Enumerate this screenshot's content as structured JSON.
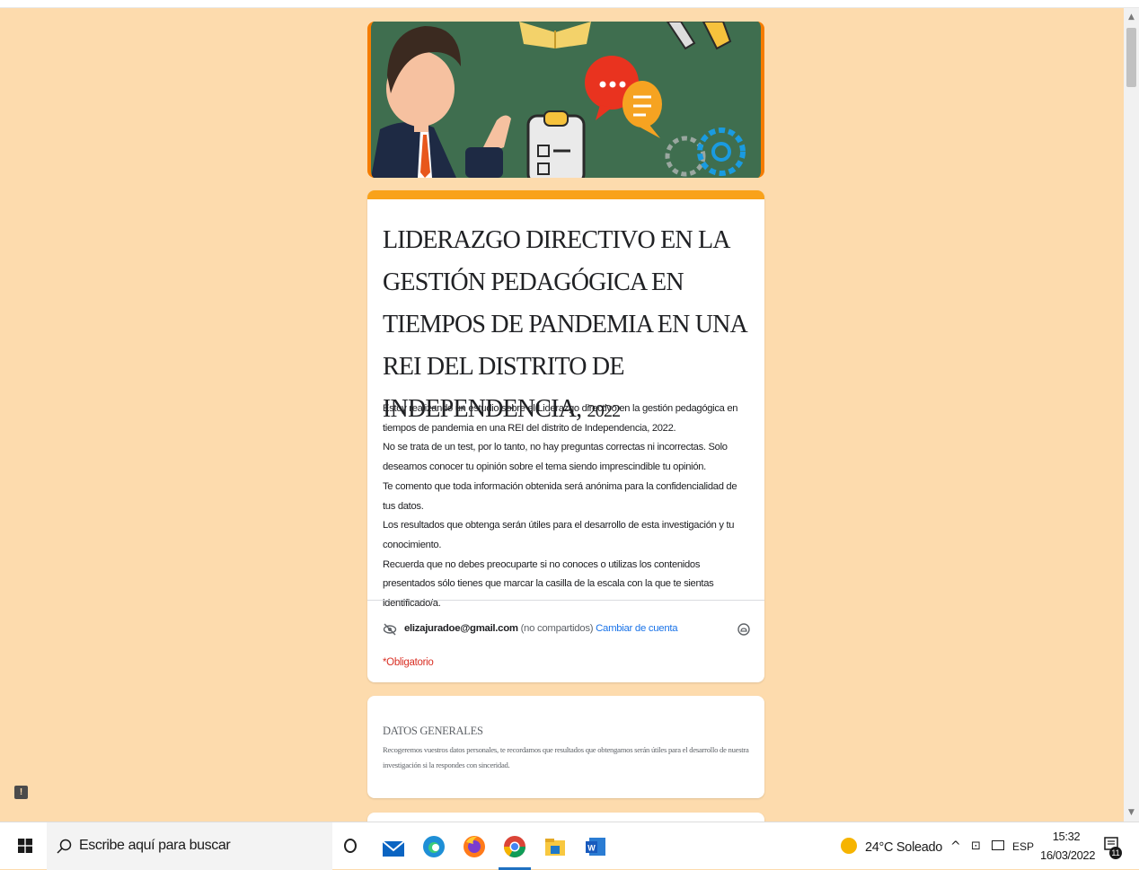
{
  "form": {
    "title_main": "LIDERAZGO DIRECTIVO EN LA GESTIÓN PEDAGÓGICA EN TIEMPOS DE PANDEMIA EN UNA REI DEL DISTRITO DE INDEPENDENCIA,",
    "title_year": "2022",
    "description": [
      "Estoy realizando un estudio sobre el Liderazgo directivo en la gestión pedagógica en tiempos de pandemia en una REI del distrito de Independencia, 2022.",
      "No se trata de un test, por lo tanto, no hay preguntas correctas ni incorrectas. Solo deseamos conocer tu opinión sobre el tema siendo imprescindible tu opinión.",
      "Te comento que toda información obtenida será anónima para la confidencialidad de tus datos.",
      "Los resultados que obtenga serán útiles para el desarrollo de esta investigación y tu conocimiento.",
      " Recuerda que no debes preocuparte si no conoces o utilizas los contenidos presentados sólo tienes que marcar la casilla de la escala con la que te sientas identificado/a."
    ],
    "account_email": "elizajuradoe@gmail.com",
    "account_note": "(no compartidos)",
    "switch_account": "Cambiar de cuenta",
    "required_note": "*Obligatorio"
  },
  "section": {
    "title": "DATOS GENERALES",
    "description": "Recogeremos vuestros datos personales, te recordamos que resultados que obtengamos serán útiles para el desarrollo de nuestra investigación si la respondes con sinceridad."
  },
  "taskbar": {
    "search_placeholder": "Escribe aquí para buscar",
    "weather": "24°C  Soleado",
    "language": "ESP",
    "time": "15:32",
    "date": "16/03/2022",
    "notification_count": "11"
  },
  "colors": {
    "page_background": "#fddbad",
    "form_accent": "#f9a21a",
    "banner_green": "#3f6e4f",
    "banner_border": "#f57c00",
    "link_blue": "#1a73e8",
    "required_red": "#d93025"
  }
}
